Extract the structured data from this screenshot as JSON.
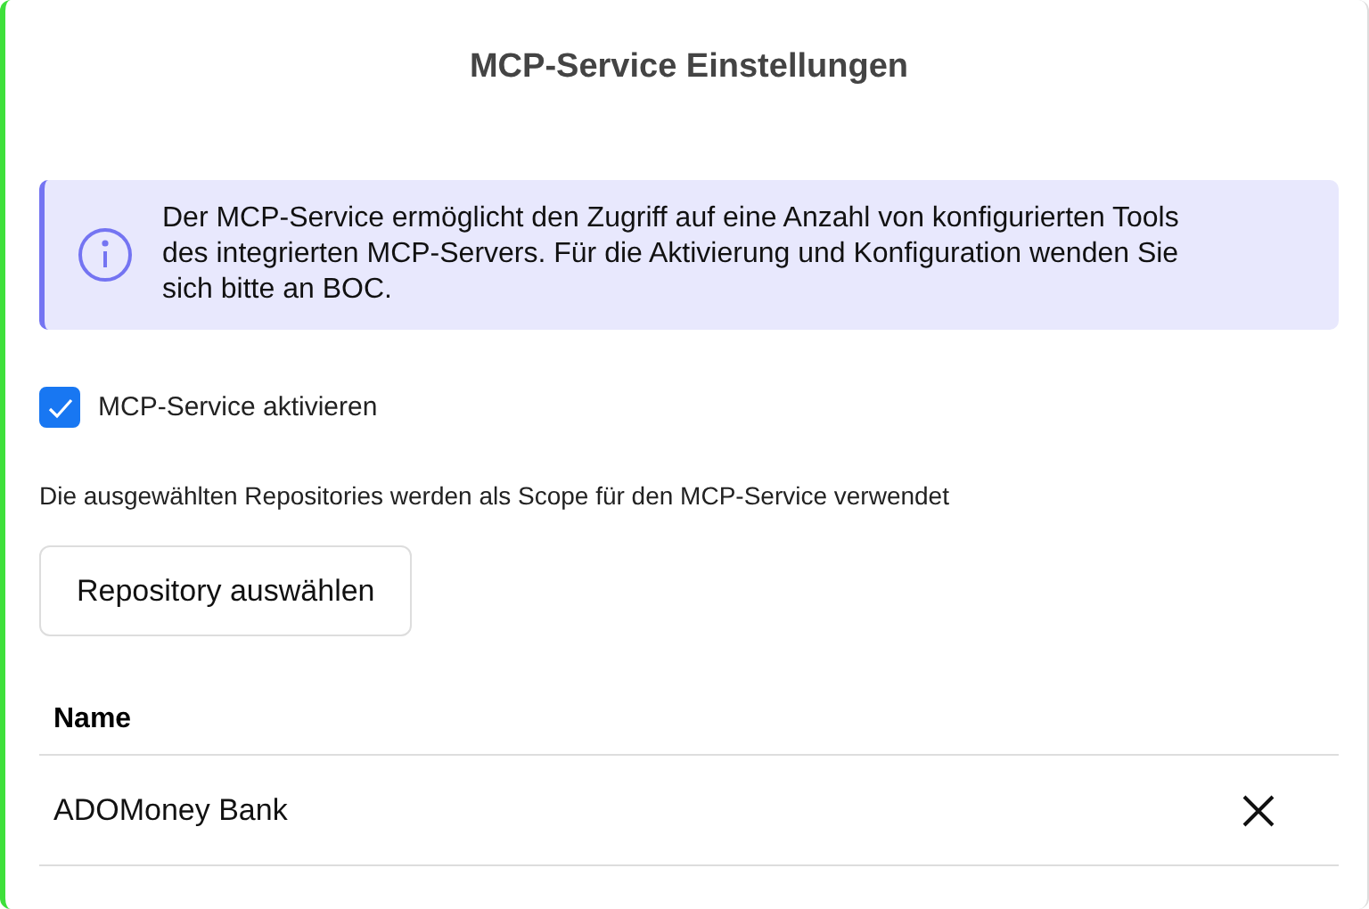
{
  "title": "MCP-Service Einstellungen",
  "info": "Der MCP-Service ermöglicht den Zugriff auf eine Anzahl von konfigurierten Tools des integrierten MCP-Servers. Für die Aktivierung und Konfiguration wenden Sie sich bitte an BOC.",
  "enable": {
    "label": "MCP-Service aktivieren",
    "checked": true
  },
  "description": "Die ausgewählten Repositories werden als Scope für den MCP-Service verwendet",
  "select_button": "Repository auswählen",
  "table": {
    "columns": [
      "Name"
    ],
    "rows": [
      {
        "name": "ADOMoney Bank"
      }
    ]
  }
}
